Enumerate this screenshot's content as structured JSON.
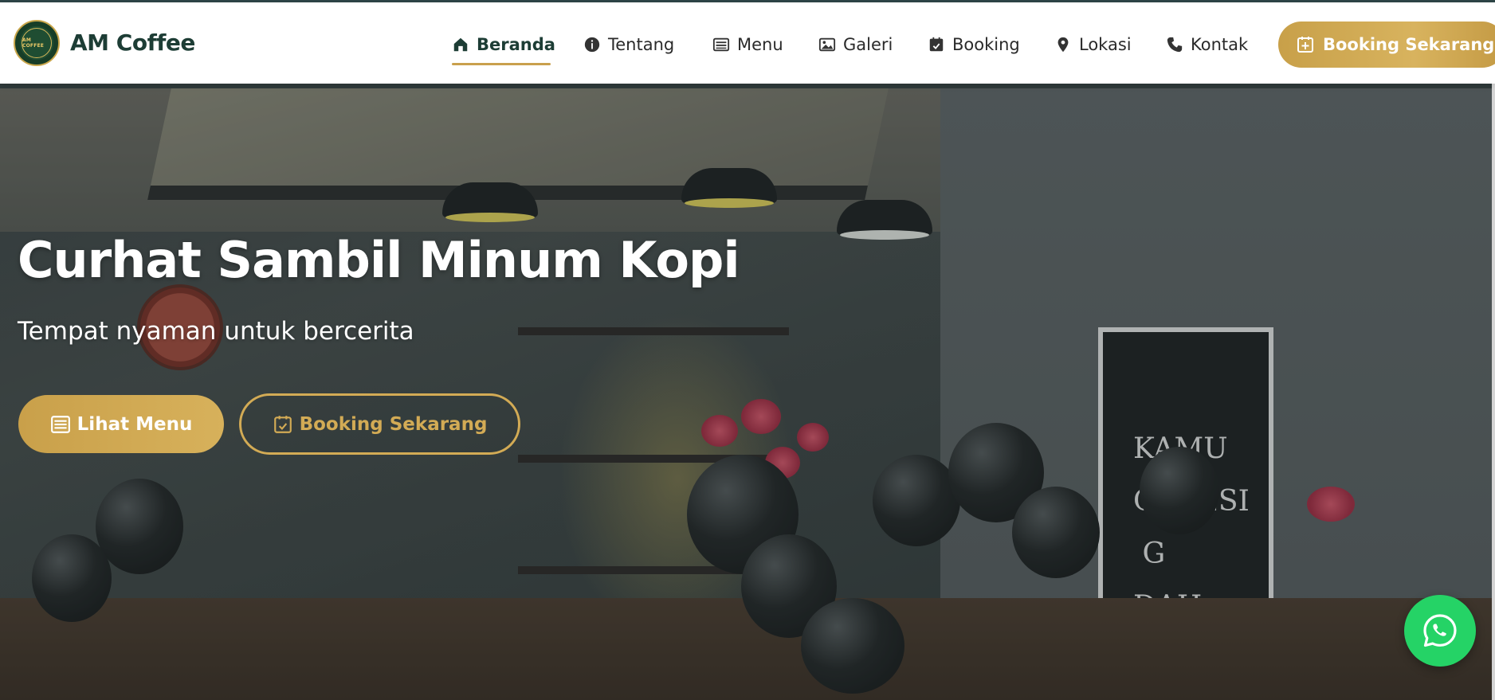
{
  "brand": {
    "name": "AM Coffee",
    "logo_text": "AM COFFEE"
  },
  "nav": {
    "items": [
      {
        "label": "Beranda",
        "icon": "home-icon",
        "active": true
      },
      {
        "label": "Tentang",
        "icon": "info-icon",
        "active": false
      },
      {
        "label": "Menu",
        "icon": "menu-list-icon",
        "active": false
      },
      {
        "label": "Galeri",
        "icon": "image-icon",
        "active": false
      },
      {
        "label": "Booking",
        "icon": "calendar-check-icon",
        "active": false
      },
      {
        "label": "Lokasi",
        "icon": "map-pin-icon",
        "active": false
      },
      {
        "label": "Kontak",
        "icon": "phone-icon",
        "active": false
      }
    ],
    "cta_label": "Booking Sekarang"
  },
  "hero": {
    "title": "Curhat Sambil Minum Kopi",
    "subtitle": "Tempat nyaman untuk bercerita",
    "primary_button": "Lihat Menu",
    "secondary_button": "Booking Sekarang",
    "door_text": "KAMU\nOBSESI\nG\nDAH"
  },
  "colors": {
    "primary_dark": "#1d3d35",
    "gold": "#c9a04d",
    "whatsapp": "#25d366",
    "white": "#ffffff"
  },
  "floating": {
    "whatsapp_icon": "whatsapp-icon"
  }
}
